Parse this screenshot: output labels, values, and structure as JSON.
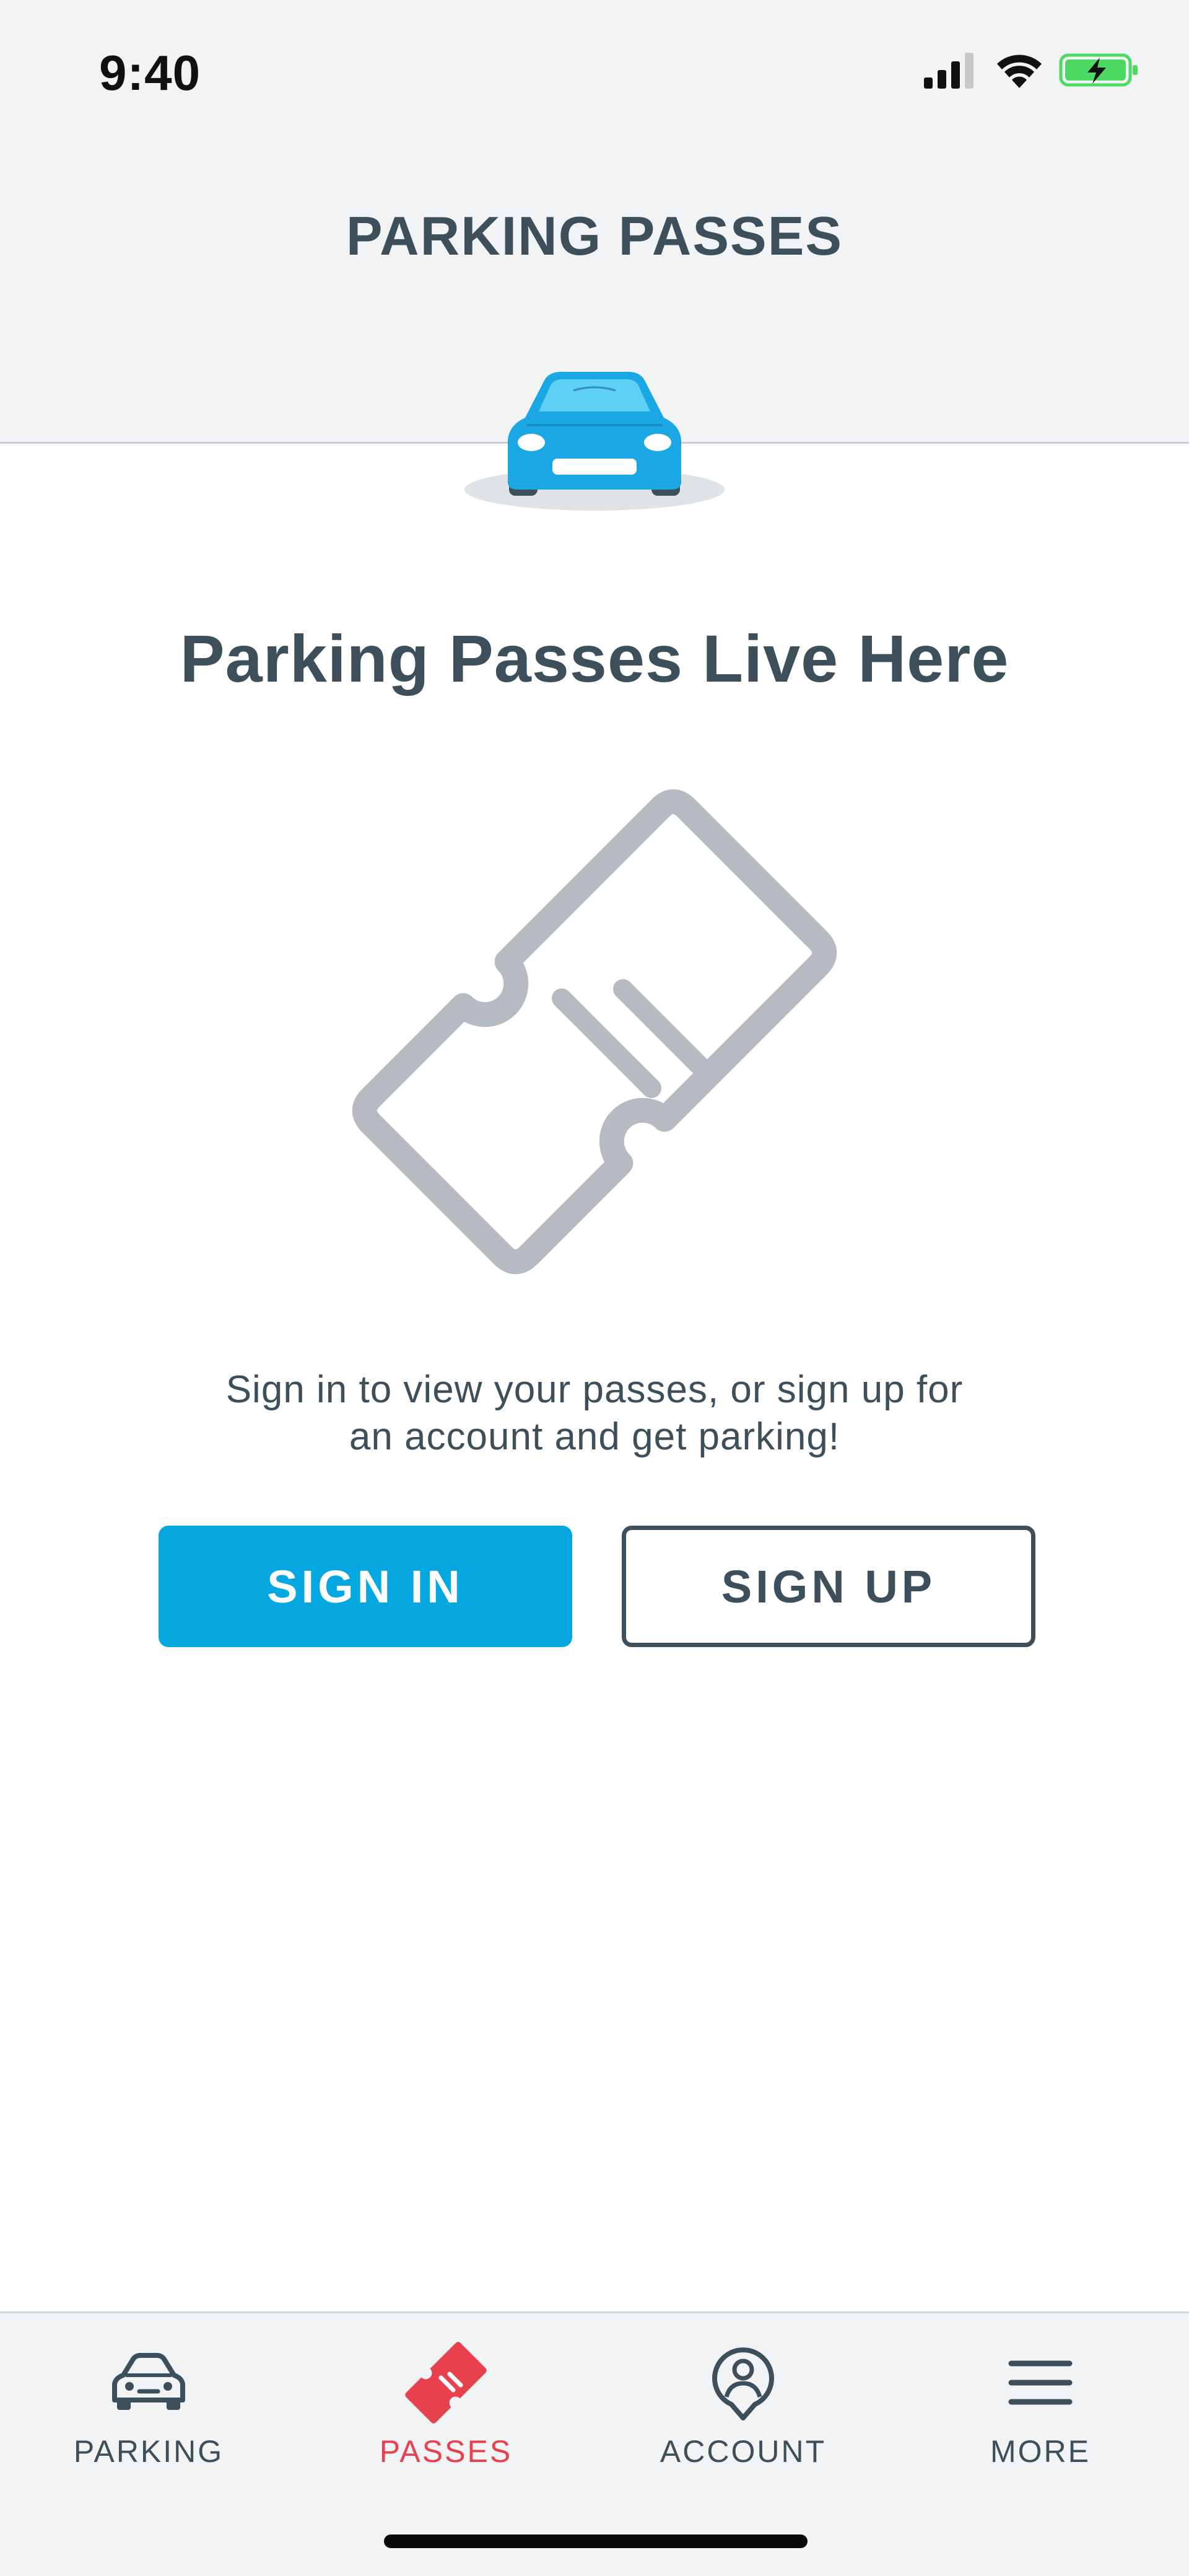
{
  "status_bar": {
    "time": "9:40",
    "icons": [
      "signal-icon",
      "wifi-icon",
      "battery-charging-icon"
    ]
  },
  "header": {
    "title": "PARKING PASSES",
    "illustration": "car-icon"
  },
  "main": {
    "heading": "Parking Passes Live Here",
    "illustration": "ticket-icon",
    "message_line1": "Sign in to view your passes, or sign up for",
    "message_line2": "an account and get parking!",
    "sign_in_label": "SIGN IN",
    "sign_up_label": "SIGN UP"
  },
  "tabbar": {
    "active": "passes",
    "tabs": [
      {
        "id": "parking",
        "label": "PARKING",
        "icon": "car-icon"
      },
      {
        "id": "passes",
        "label": "PASSES",
        "icon": "ticket-icon"
      },
      {
        "id": "account",
        "label": "ACCOUNT",
        "icon": "account-pin-icon"
      },
      {
        "id": "more",
        "label": "MORE",
        "icon": "menu-icon"
      }
    ]
  },
  "colors": {
    "primary_blue": "#05a7e0",
    "text_slate": "#3e4f5c",
    "active_red": "#e8414d",
    "icon_gray": "#b5bbc0",
    "header_bg": "#f1f3f5",
    "battery_green": "#4cd964"
  }
}
